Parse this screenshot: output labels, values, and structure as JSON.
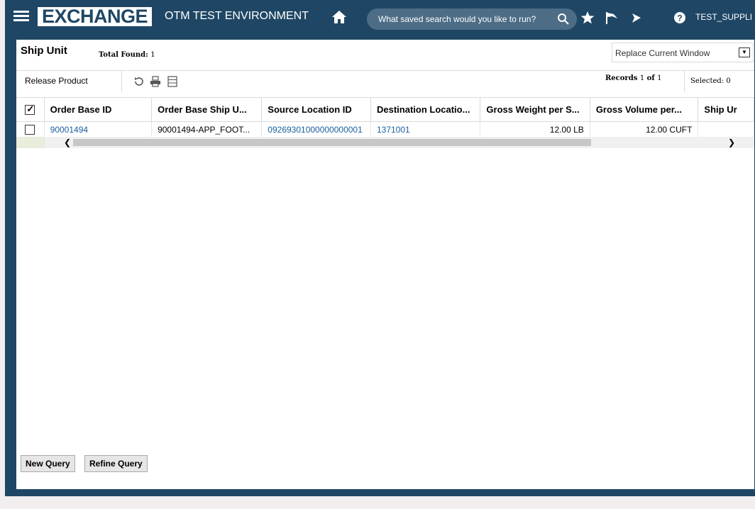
{
  "header": {
    "logo": "EXCHANGE",
    "environment": "OTM TEST ENVIRONMENT",
    "search_placeholder": "What saved search would you like to run?",
    "user": "TEST_SUPPLI",
    "icons": [
      "menu-icon",
      "home-icon",
      "search-icon",
      "star-icon",
      "flag-icon",
      "bell-icon",
      "help-icon"
    ],
    "bar_color": "#1f4765"
  },
  "page": {
    "title": "Ship Unit",
    "total_found_label": "Total Found:",
    "total_found_value": "1",
    "window_mode": "Replace Current Window"
  },
  "toolbar": {
    "release_label": "Release Product",
    "icons": [
      "refresh-icon",
      "print-icon",
      "columns-icon"
    ],
    "records_label": "Records",
    "records_from": "1",
    "records_of_label": "of",
    "records_total": "1",
    "selected_label": "Selected:",
    "selected_count": "0"
  },
  "table": {
    "columns": [
      "Order Base ID",
      "Order Base Ship U...",
      "Source Location ID",
      "Destination Locatio...",
      "Gross Weight per S...",
      "Gross Volume per...",
      "Ship Ur"
    ],
    "rows": [
      {
        "order_base_id": "90001494",
        "order_base_ship_unit": "90001494-APP_FOOT...",
        "source_location_id": "09269301000000000001",
        "destination_location": "1371001",
        "gross_weight": "12.00 LB",
        "gross_volume": "12.00 CUFT",
        "ship_unit": ""
      }
    ]
  },
  "footer": {
    "new_query": "New Query",
    "refine_query": "Refine Query"
  },
  "colors": {
    "brand": "#1f4765",
    "link": "#1a5fa0"
  }
}
